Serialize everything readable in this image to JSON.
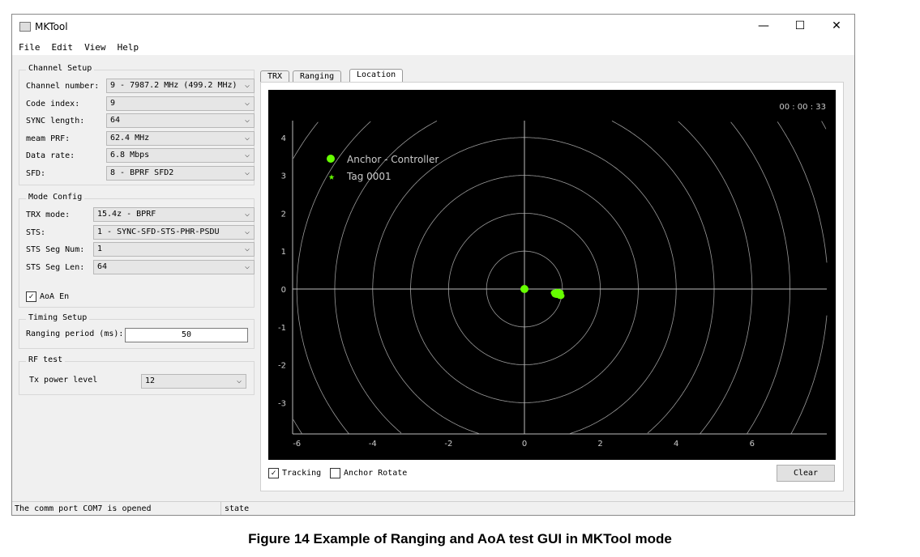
{
  "window": {
    "title": "MKTool",
    "minimize": "—",
    "maximize": "☐",
    "close": "✕"
  },
  "menu": [
    "File",
    "Edit",
    "View",
    "Help"
  ],
  "channel_setup": {
    "title": "Channel Setup",
    "fields": [
      {
        "label": "Channel number:",
        "value": "9 - 7987.2 MHz (499.2 MHz)"
      },
      {
        "label": "Code index:",
        "value": "9"
      },
      {
        "label": "SYNC length:",
        "value": "64"
      },
      {
        "label": "meam PRF:",
        "value": "62.4 MHz"
      },
      {
        "label": "Data rate:",
        "value": "6.8 Mbps"
      },
      {
        "label": "SFD:",
        "value": "8 - BPRF SFD2"
      }
    ]
  },
  "mode_config": {
    "title": "Mode Config",
    "fields": [
      {
        "label": "TRX mode:",
        "value": "15.4z - BPRF"
      },
      {
        "label": "STS:",
        "value": "1 - SYNC-SFD-STS-PHR-PSDU"
      },
      {
        "label": "STS Seg Num:",
        "value": "1"
      },
      {
        "label": "STS Seg Len:",
        "value": "64"
      }
    ],
    "aoa_label": "AoA En",
    "aoa_checked": true
  },
  "timing": {
    "title": "Timing Setup",
    "label": "Ranging period (ms):",
    "value": "50"
  },
  "rf_test": {
    "title": "RF test",
    "label": "Tx power level",
    "value": "12"
  },
  "tabs": [
    "TRX",
    "Ranging",
    "Location"
  ],
  "active_tab": "Location",
  "plot": {
    "timer": "00 : 00 : 33",
    "legend": [
      "Anchor - Controller",
      "Tag 0001"
    ],
    "accent": "#66ff00"
  },
  "chart_data": {
    "type": "scatter",
    "xlim": [
      -6.3,
      7.9
    ],
    "ylim": [
      -4,
      4.5
    ],
    "xticks": [
      -6,
      -4,
      -2,
      0,
      2,
      4,
      6
    ],
    "yticks": [
      -3,
      -2,
      -1,
      0,
      1,
      2,
      3,
      4
    ],
    "ring_radii": [
      1,
      2,
      3,
      4,
      5,
      6,
      7,
      8,
      9
    ],
    "series": [
      {
        "name": "Anchor - Controller",
        "points": [
          [
            0,
            0
          ]
        ]
      },
      {
        "name": "Tag 0001",
        "points": [
          [
            0.8,
            -0.1
          ],
          [
            0.85,
            -0.15
          ],
          [
            0.9,
            -0.12
          ],
          [
            0.95,
            -0.18
          ],
          [
            0.88,
            -0.08
          ],
          [
            0.82,
            -0.14
          ],
          [
            0.93,
            -0.1
          ]
        ]
      }
    ]
  },
  "tracking": {
    "label": "Tracking",
    "checked": true
  },
  "anchor_rotate": {
    "label": "Anchor Rotate",
    "checked": false
  },
  "clear_label": "Clear",
  "status": {
    "message": "The comm port COM7 is opened",
    "state": "state"
  },
  "caption": "Figure 14 Example of Ranging and AoA test GUI in MKTool mode"
}
